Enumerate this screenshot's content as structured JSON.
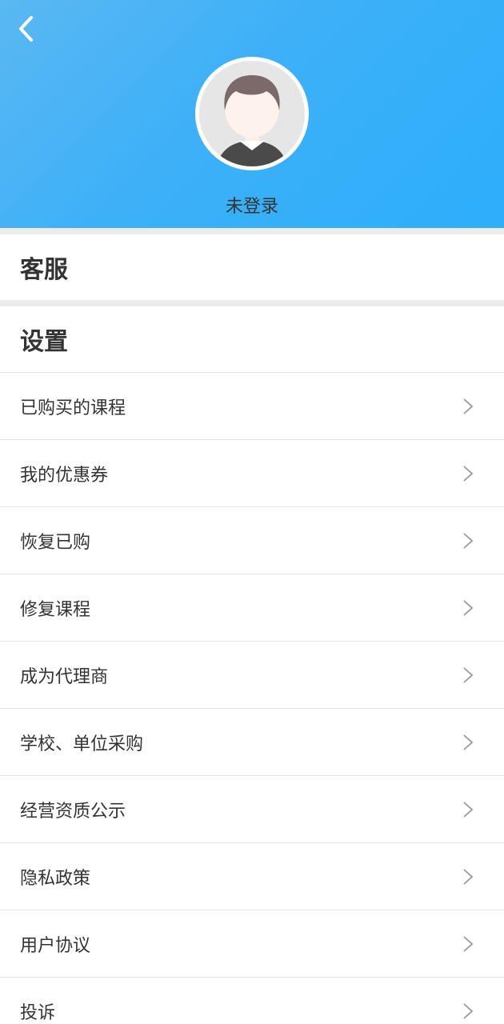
{
  "header": {
    "back_icon": "chevron-left-icon",
    "avatar_icon": "default-avatar-icon",
    "login_status": "未登录",
    "colors": {
      "gradient_start": "#5ab8f2",
      "gradient_end": "#2daefb"
    }
  },
  "sections": {
    "service_title": "客服",
    "settings_title": "设置"
  },
  "menu": {
    "items": [
      {
        "label": "已购买的课程"
      },
      {
        "label": "我的优惠券"
      },
      {
        "label": "恢复已购"
      },
      {
        "label": "修复课程"
      },
      {
        "label": "成为代理商"
      },
      {
        "label": "学校、单位采购"
      },
      {
        "label": "经营资质公示"
      },
      {
        "label": "隐私政策"
      },
      {
        "label": "用户协议"
      },
      {
        "label": "投诉"
      }
    ],
    "chevron_icon": "chevron-right-icon"
  }
}
